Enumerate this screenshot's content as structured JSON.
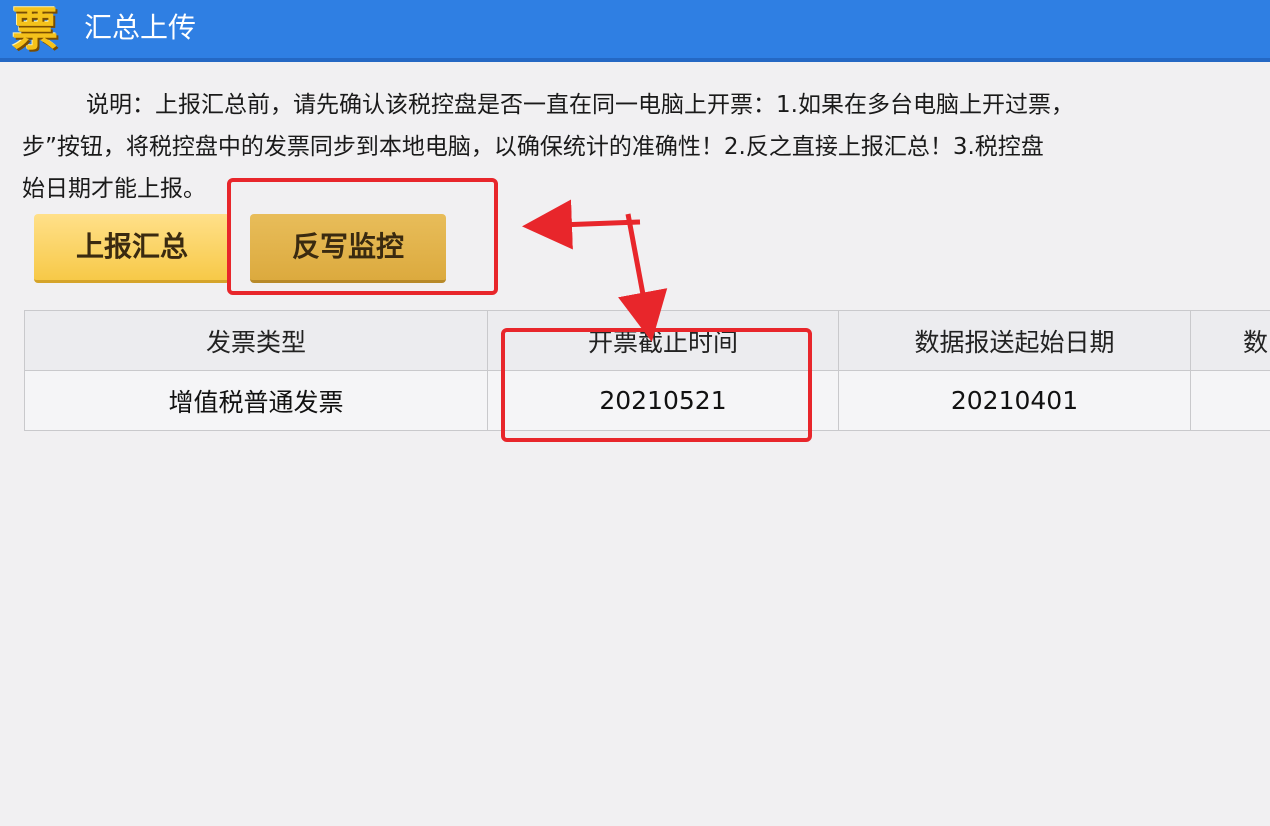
{
  "window": {
    "logo_char": "票",
    "title": "汇总上传"
  },
  "note": {
    "line1": "说明：上报汇总前，请先确认该税控盘是否一直在同一电脑上开票：1.如果在多台电脑上开过票，",
    "line2": "步”按钮，将税控盘中的发票同步到本地电脑，以确保统计的准确性！2.反之直接上报汇总！3.税控盘",
    "line3": "始日期才能上报。"
  },
  "buttons": {
    "report_label": "上报汇总",
    "writeback_label": "反写监控"
  },
  "table": {
    "headers": [
      "发票类型",
      "开票截止时间",
      "数据报送起始日期",
      "数"
    ],
    "rows": [
      [
        "增值税普通发票",
        "20210521",
        "20210401",
        ""
      ]
    ]
  },
  "colors": {
    "titlebar": "#2f7fe3",
    "annotation_red": "#e8262b",
    "button_yellow": "#f7c948",
    "button_gold": "#dcaa3e"
  }
}
